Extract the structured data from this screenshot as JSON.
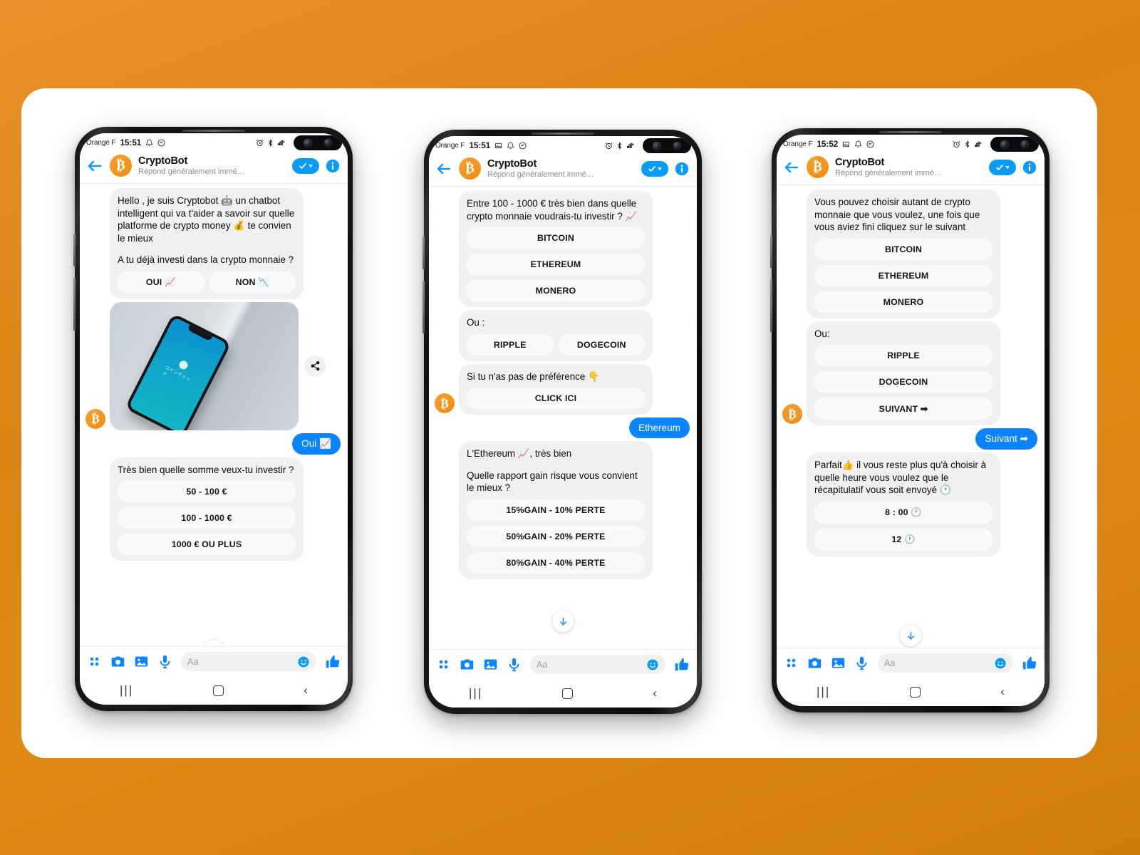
{
  "theme": {
    "accent_blue": "#0a84ff",
    "bitcoin_orange": "#ef8c13",
    "background_orange": "#db8413",
    "bot_bubble_gray": "#f0f0f0"
  },
  "phones": [
    {
      "id": "phone-1",
      "status_bar": {
        "carrier": "Orange F",
        "time": "15:51",
        "icons_left": [
          "bell-icon",
          "messenger-icon"
        ],
        "icons_right": [
          "alarm-icon",
          "bluetooth-icon",
          "signal-mute-icon"
        ]
      },
      "header": {
        "title": "CryptoBot",
        "subtitle": "Répond généralement immé…",
        "back_icon": "back-arrow-icon",
        "avatar": "bitcoin-avatar",
        "call_pill": "check-pill",
        "info_icon": "info-icon"
      },
      "messages": [
        {
          "type": "bot-card",
          "paragraphs": [
            "Hello , je suis Cryptobot 🤖 un chatbot intelligent qui va t'aider a savoir sur quelle platforme de crypto money 💰 te convien le mieux",
            "A tu déjà investi dans la crypto monnaie ?"
          ],
          "button_row": [
            "OUI 📈",
            "NON 📉"
          ]
        },
        {
          "type": "image",
          "alt": "smartphone-on-desk-photo",
          "share_icon": "share-icon"
        },
        {
          "type": "user",
          "text": "Oui 📈"
        },
        {
          "type": "bot-card",
          "paragraphs": [
            "Très bien quelle somme veux-tu investir  ?"
          ],
          "buttons": [
            "50 - 100 €",
            "100 - 1000 €",
            "1000 € OU PLUS"
          ]
        }
      ],
      "composer": {
        "placeholder": "Aa",
        "icons": [
          "apps-grid-icon",
          "camera-icon",
          "gallery-icon",
          "microphone-icon"
        ],
        "emoji_icon": "emoji-icon",
        "like_icon": "thumbs-up-icon"
      },
      "navbar": [
        "recents-icon",
        "home-icon",
        "back-icon"
      ],
      "scroll_fab": "scroll-down-icon"
    },
    {
      "id": "phone-2",
      "status_bar": {
        "carrier": "Orange F",
        "time": "15:51",
        "icons_left": [
          "image-icon",
          "bell-icon",
          "messenger-icon"
        ],
        "icons_right": [
          "alarm-icon",
          "bluetooth-icon",
          "signal-mute-icon"
        ]
      },
      "header": {
        "title": "CryptoBot",
        "subtitle": "Répond généralement immé…",
        "back_icon": "back-arrow-icon",
        "avatar": "bitcoin-avatar",
        "call_pill": "check-pill",
        "info_icon": "info-icon"
      },
      "messages": [
        {
          "type": "bot-card",
          "paragraphs": [
            "Entre 100 - 1000 € très bien dans quelle crypto monnaie voudrais-tu investir  ? 📈"
          ],
          "buttons": [
            "BITCOIN",
            "ETHEREUM",
            "MONERO"
          ]
        },
        {
          "type": "bot-card",
          "paragraphs": [
            "Ou :"
          ],
          "button_row": [
            "RIPPLE",
            "DOGECOIN"
          ]
        },
        {
          "type": "bot-card",
          "paragraphs": [
            "Si tu n'as pas de préférence 👇"
          ],
          "buttons": [
            "CLICK ICI"
          ]
        },
        {
          "type": "user",
          "text": "Ethereum"
        },
        {
          "type": "bot-card",
          "paragraphs": [
            "L'Ethereum 📈, très bien",
            "Quelle rapport gain risque vous convient le mieux ?"
          ],
          "buttons": [
            "15%GAIN - 10% PERTE",
            "50%GAIN - 20% PERTE",
            "80%GAIN - 40% PERTE"
          ]
        }
      ],
      "composer": {
        "placeholder": "Aa",
        "icons": [
          "apps-grid-icon",
          "camera-icon",
          "gallery-icon",
          "microphone-icon"
        ],
        "emoji_icon": "emoji-icon",
        "like_icon": "thumbs-up-icon"
      },
      "navbar": [
        "recents-icon",
        "home-icon",
        "back-icon"
      ],
      "scroll_fab": "scroll-down-icon"
    },
    {
      "id": "phone-3",
      "status_bar": {
        "carrier": "Orange F",
        "time": "15:52",
        "icons_left": [
          "image-icon",
          "bell-icon",
          "messenger-icon"
        ],
        "icons_right": [
          "alarm-icon",
          "bluetooth-icon",
          "signal-mute-icon"
        ]
      },
      "header": {
        "title": "CryptoBot",
        "subtitle": "Répond généralement immé…",
        "back_icon": "back-arrow-icon",
        "avatar": "bitcoin-avatar",
        "call_pill": "check-pill",
        "info_icon": "info-icon"
      },
      "messages": [
        {
          "type": "bot-card",
          "paragraphs": [
            "Vous pouvez choisir autant de crypto monnaie que vous voulez, une fois que vous aviez fini cliquez sur le suivant"
          ],
          "buttons": [
            "BITCOIN",
            "ETHEREUM",
            "MONERO"
          ]
        },
        {
          "type": "bot-card",
          "paragraphs": [
            "Ou:"
          ],
          "buttons": [
            "RIPPLE",
            "DOGECOIN",
            "SUIVANT ➡"
          ]
        },
        {
          "type": "user",
          "text": "Suivant ➡"
        },
        {
          "type": "bot-card",
          "paragraphs": [
            "Parfait👍  il vous reste plus qu'à choisir à quelle heure vous voulez que le récapitulatif vous soit envoyé 🕐"
          ],
          "buttons": [
            "8 : 00 🕐",
            "12 🕐"
          ]
        }
      ],
      "composer": {
        "placeholder": "Aa",
        "icons": [
          "apps-grid-icon",
          "camera-icon",
          "gallery-icon",
          "microphone-icon"
        ],
        "emoji_icon": "emoji-icon",
        "like_icon": "thumbs-up-icon"
      },
      "navbar": [
        "recents-icon",
        "home-icon",
        "back-icon"
      ],
      "scroll_fab": "scroll-down-icon"
    }
  ]
}
